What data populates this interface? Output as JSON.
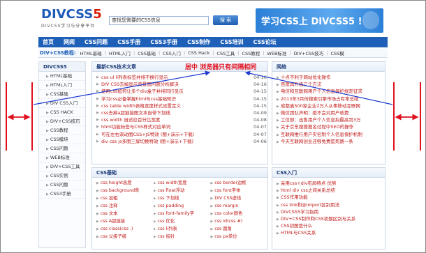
{
  "logo": {
    "div": "DIV",
    "css": "CSS",
    "five": "5",
    "subtitle": "DIVCSS学习与分享平台"
  },
  "search": {
    "placeholder": "查找您需要的CSS信息",
    "button": "搜 索"
  },
  "banner": {
    "text": "学习CSS上 DIVCSS5 !"
  },
  "nav": [
    "首页",
    "网闻",
    "CSS问题",
    "CSS手册",
    "CSS3手册",
    "CSS制作",
    "CSS培训",
    "CSS论坛"
  ],
  "subnav": {
    "title": "DIV+CSS教程:",
    "items": [
      "HTML基础",
      "HTML入门",
      "CSS基础",
      "CSS入门",
      "CSS Hack",
      "CSS工具",
      "CSS教程",
      "WEB标准",
      "DIV+CSS技巧",
      "CSS模"
    ]
  },
  "sidebar": {
    "title": "DIVCSS5",
    "items": [
      "HTML基础",
      "HTML入门",
      "CSS基础",
      "DIV CSS入门",
      "CSS HACK",
      "DIV+CSS技巧",
      "CSS教程",
      "CSS模块",
      "CSS问题",
      "WEB标准",
      "DIV+CSS工具",
      "CSS实例",
      "CSS问题",
      "CSS3手册"
    ]
  },
  "latest": {
    "title": "最新CSS技术文章",
    "rows": [
      {
        "t": "css ul li列表标签并排不换行显示",
        "d": "04-16"
      },
      {
        "t": "DIV CSS去掉显示背景图问题分析解决",
        "d": "04-16"
      },
      {
        "t": "使用css如何让多个div盒子并排同行显示",
        "d": "04-15"
      },
      {
        "t": "学习css必备掌握html与css基础知识",
        "d": "04-15"
      },
      {
        "t": "css table width表格宽度样式设置定义",
        "d": "04-15"
      },
      {
        "t": "css去掉a超链接图文本自带下划线",
        "d": "04-09"
      },
      {
        "t": "css width 自适应百分比宽度",
        "d": "04-08"
      },
      {
        "t": "html功能标签与CSS样式对应单词",
        "d": "04-07"
      },
      {
        "t": "可在左右滚动图CSS+JS特效 (图+演示+下载)",
        "d": "04-07"
      },
      {
        "t": "div css js多图三屏切换特效 (图+演示+下载)",
        "d": "04-06"
      }
    ]
  },
  "annotation": {
    "label": "居中 浏览器只有间隔相同"
  },
  "network": {
    "title": "网络",
    "rows": [
      "十点不利于网站优化操作",
      "百度再升级三个方法",
      "电信和互联网用户个人信息保护规定征求",
      "2013年3月份搜索引擎市场占有率总结",
      "成都逾500家企业2万人从事移动互联网",
      "微信团队声明：绝不会对用户收费",
      "工信部：出售用户个人信息拟最高罚3万",
      "关于京东搜搜推名过程中SEO的操作",
      "互联网推行用户实名制个人信息保护机制",
      "今天互联网创业还够免费是死路一条"
    ]
  },
  "css_basic": {
    "title": "CSS基础",
    "cells": [
      "css height高度",
      "css width宽度",
      "css border边框",
      "css background背",
      "css float浮动",
      "css font字体",
      "css 加粗",
      "css 下划线",
      "DIV CSS虚线",
      "css 注释",
      "css padding",
      "css margin",
      "css 文本",
      "css font-family字",
      "css color颜色",
      "css A超链接",
      "css 优化",
      "css id(css #)",
      "css class(css .)",
      "css li列表",
      "css 圆角",
      "css 父级子级",
      "css 指针",
      "css px单位"
    ]
  },
  "css_intro": {
    "title": "CSS入门",
    "rows": [
      "采用css+div布局特点 优势",
      "html div css之间关系总结",
      "CSS作用功能",
      "css link和@import区别用法",
      "DIVCSS5学习指南",
      "DIV+CSS制作和CSS初题区别与关系",
      "CSS初图是什么",
      "HTML与CSS关系"
    ]
  }
}
